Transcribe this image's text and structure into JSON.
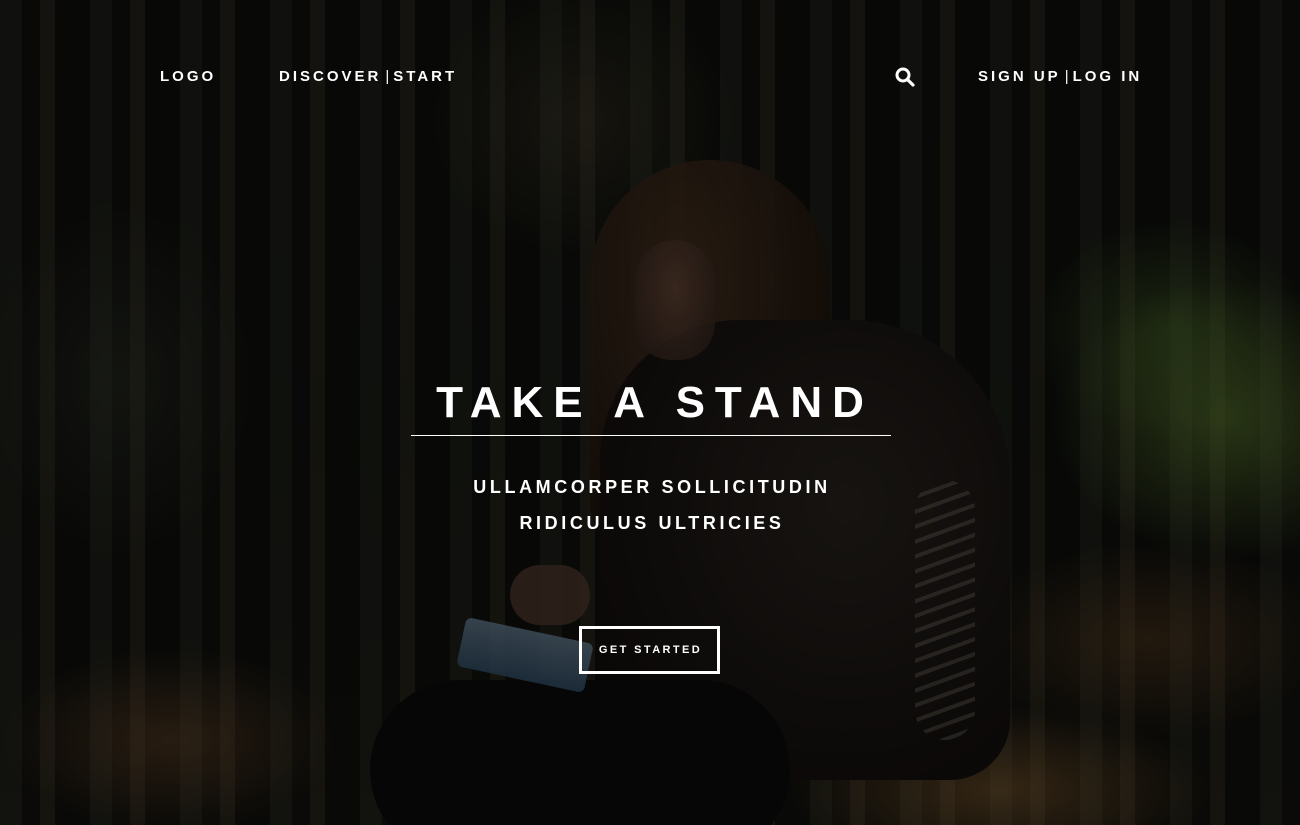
{
  "nav": {
    "logo": "LOGO",
    "left_links": [
      {
        "label": "DISCOVER"
      },
      {
        "label": "START"
      }
    ],
    "separator": "|",
    "search_icon": "search-icon",
    "right_links": [
      {
        "label": "SIGN UP"
      },
      {
        "label": "LOG IN"
      }
    ]
  },
  "hero": {
    "title": "TAKE A STAND",
    "subtitle_line1": "ULLAMCORPER SOLLICITUDIN",
    "subtitle_line2": "RIDICULUS ULTRICIES",
    "cta_label": "GET STARTED"
  },
  "colors": {
    "text": "#ffffff",
    "overlay": "#000000"
  }
}
